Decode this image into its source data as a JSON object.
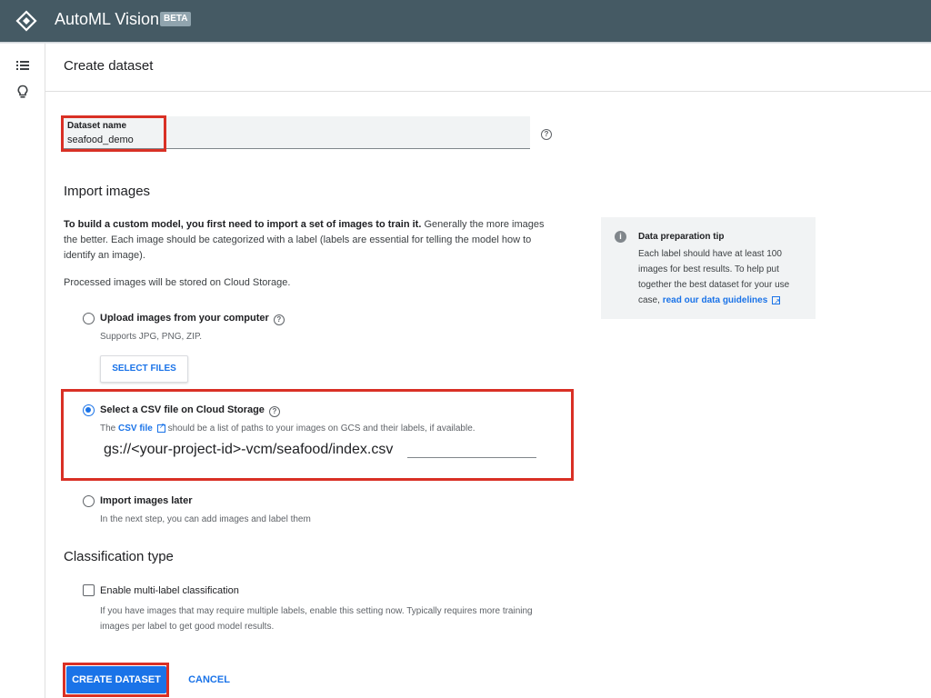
{
  "app": {
    "title": "AutoML Vision",
    "badge": "BETA",
    "logo_icon": "automl-diamond-logo"
  },
  "rail": {
    "items": [
      {
        "icon": "list-icon"
      },
      {
        "icon": "lightbulb-icon"
      }
    ]
  },
  "page": {
    "title": "Create dataset"
  },
  "dataset_name": {
    "label": "Dataset name",
    "value": "seafood_demo",
    "help_icon": "help-circle-icon"
  },
  "import": {
    "heading": "Import images",
    "intro_bold": "To build a custom model, you first need to import a set of images to train it.",
    "intro_rest": " Generally the more images the better. Each image should be categorized with a label (labels are essential for telling the model how to identify an image).",
    "storage_note": "Processed images will be stored on Cloud Storage.",
    "options": [
      {
        "label": "Upload images from your computer",
        "sub": "Supports JPG, PNG, ZIP.",
        "selected": false
      },
      {
        "label": "Select a CSV file on Cloud Storage",
        "sub_prefix": "The ",
        "sub_link": "CSV file",
        "sub_suffix": " should be a list of paths to your images on GCS and their labels, if available.",
        "selected": true
      },
      {
        "label": "Import images later",
        "sub": "In the next step, you can add images and label them",
        "selected": false
      }
    ],
    "select_files_button": "SELECT FILES",
    "csv_path_value": "gs://<your-project-id>-vcm/seafood/index.csv"
  },
  "classification": {
    "heading": "Classification type",
    "checkbox_label": "Enable multi-label classification",
    "checkbox_checked": false,
    "note": "If you have images that may require multiple labels, enable this setting now. Typically requires more training images per label to get good model results."
  },
  "tip": {
    "title": "Data preparation tip",
    "body": "Each label should have at least 100 images for best results. To help put together the best dataset for your use case, ",
    "link": "read our data guidelines"
  },
  "actions": {
    "create": "CREATE DATASET",
    "cancel": "CANCEL"
  },
  "colors": {
    "appbar": "#455a64",
    "accent": "#1a73e8",
    "highlight_box": "#d93025"
  }
}
